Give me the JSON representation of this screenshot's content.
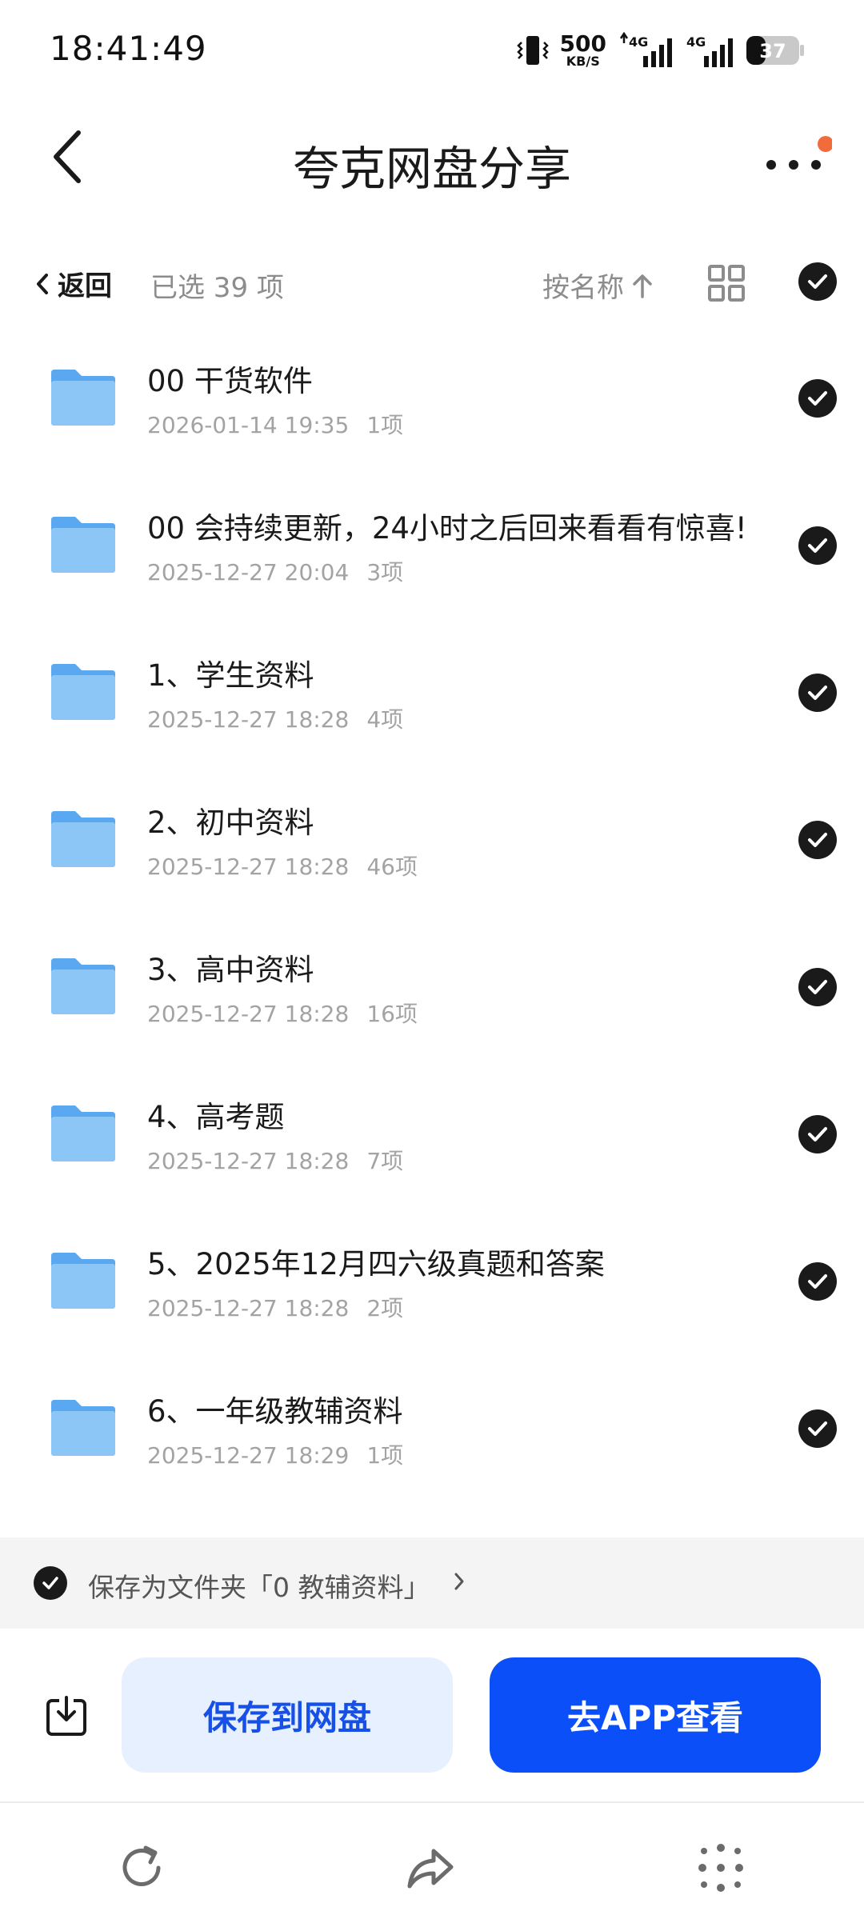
{
  "status_bar": {
    "time": "18:41:49",
    "net_speed": "500",
    "net_unit": "KB/S",
    "signal_1": "4G",
    "signal_2": "4G",
    "battery": "37"
  },
  "header": {
    "title": "夸克网盘分享",
    "back_icon": "chevron-left-icon",
    "more_icon": "more-dots-icon",
    "notification_dot_color": "#f26b3a"
  },
  "toolbar": {
    "back_label": "返回",
    "selected_text": "已选 39 项",
    "sort_label": "按名称",
    "sort_icon": "arrow-up-icon",
    "view_icon": "grid-view-icon"
  },
  "files": [
    {
      "name": "00 干货软件",
      "date": "2026-01-14 19:35",
      "count": "1项"
    },
    {
      "name": "00 会持续更新，24小时之后回来看看有惊喜!",
      "date": "2025-12-27 20:04",
      "count": "3项"
    },
    {
      "name": "1、学生资料",
      "date": "2025-12-27 18:28",
      "count": "4项"
    },
    {
      "name": "2、初中资料",
      "date": "2025-12-27 18:28",
      "count": "46项"
    },
    {
      "name": "3、高中资料",
      "date": "2025-12-27 18:28",
      "count": "16项"
    },
    {
      "name": "4、高考题",
      "date": "2025-12-27 18:28",
      "count": "7项"
    },
    {
      "name": "5、2025年12月四六级真题和答案",
      "date": "2025-12-27 18:28",
      "count": "2项"
    },
    {
      "name": "6、一年级教辅资料",
      "date": "2025-12-27 18:29",
      "count": "1项"
    }
  ],
  "save_folder": {
    "text": "保存为文件夹「0 教辅资料」",
    "chevron": "›"
  },
  "actions": {
    "save_label": "保存到网盘",
    "app_label": "去APP查看",
    "primary_color": "#0a4ff7"
  },
  "bottom_nav": {
    "refresh_icon": "refresh-icon",
    "share_icon": "share-icon",
    "menu_icon": "dots-grid-icon"
  }
}
